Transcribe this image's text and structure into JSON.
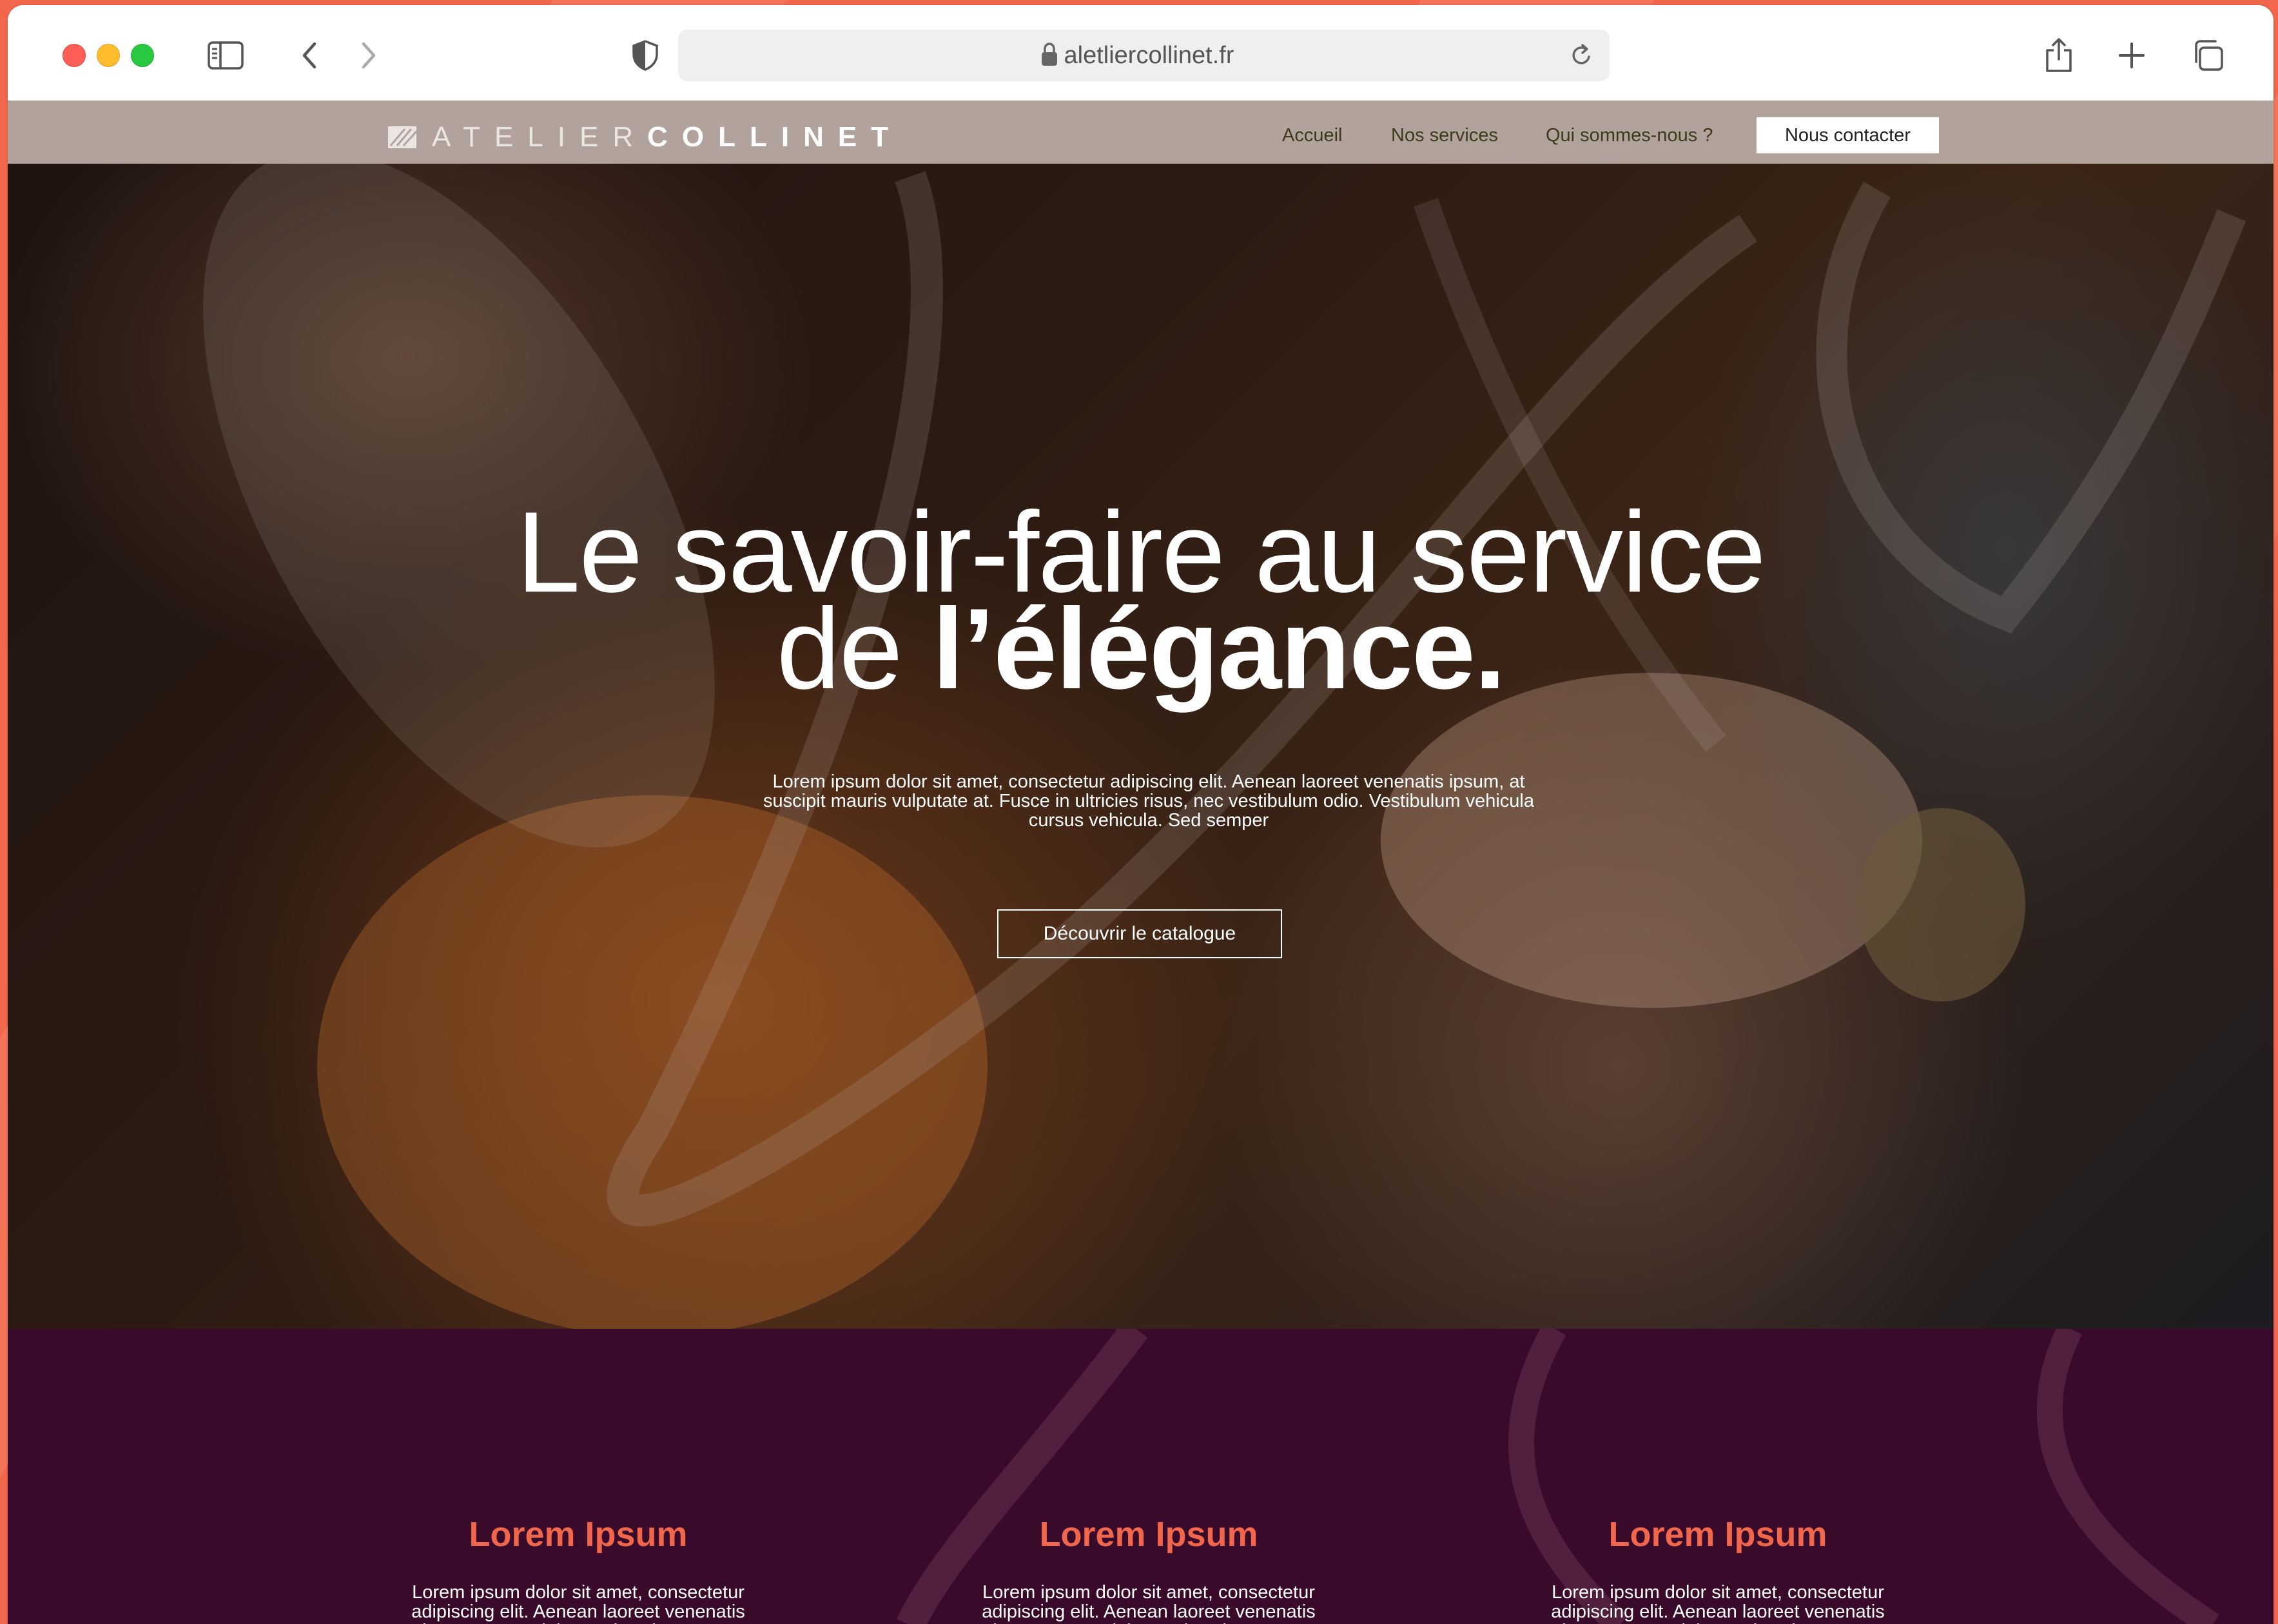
{
  "browser": {
    "url": "aletliercollinet.fr"
  },
  "site": {
    "logo_light": "ATELIER",
    "logo_bold": "COLLINET",
    "nav": [
      "Accueil",
      "Nos services",
      "Qui sommes-nous ?"
    ],
    "contact_label": "Nous contacter"
  },
  "hero": {
    "title_line1": "Le savoir-faire au service",
    "title_line2_prefix": "de ",
    "title_line2_bold": "l’élégance.",
    "description": "Lorem ipsum dolor sit amet, consectetur adipiscing elit. Aenean laoreet venenatis ipsum, at suscipit mauris vulputate at. Fusce in ultricies risus, nec vestibulum odio. Vestibulum vehicula cursus vehicula. Sed semper",
    "cta_label": "Découvrir le catalogue"
  },
  "features": [
    {
      "title": "Lorem Ipsum",
      "text": "Lorem ipsum dolor sit amet, consectetur adipiscing elit. Aenean laoreet venenatis ipsum, at suscipit mauris vulputate at."
    },
    {
      "title": "Lorem Ipsum",
      "text": "Lorem ipsum dolor sit amet, consectetur adipiscing elit. Aenean laoreet venenatis ipsum, at suscipit mauris vulputate at."
    },
    {
      "title": "Lorem Ipsum",
      "text": "Lorem ipsum dolor sit amet, consectetur adipiscing elit. Aenean laoreet venenatis ipsum, at suscipit mauris vulputate at."
    }
  ],
  "colors": {
    "accent": "#f0674c",
    "header_bg": "#b1a39b",
    "features_bg": "#3a0a2a"
  },
  "icons": [
    "sidebar-icon",
    "back-icon",
    "forward-icon",
    "shield-icon",
    "lock-icon",
    "reload-icon",
    "share-icon",
    "new-tab-icon",
    "tabs-icon"
  ]
}
